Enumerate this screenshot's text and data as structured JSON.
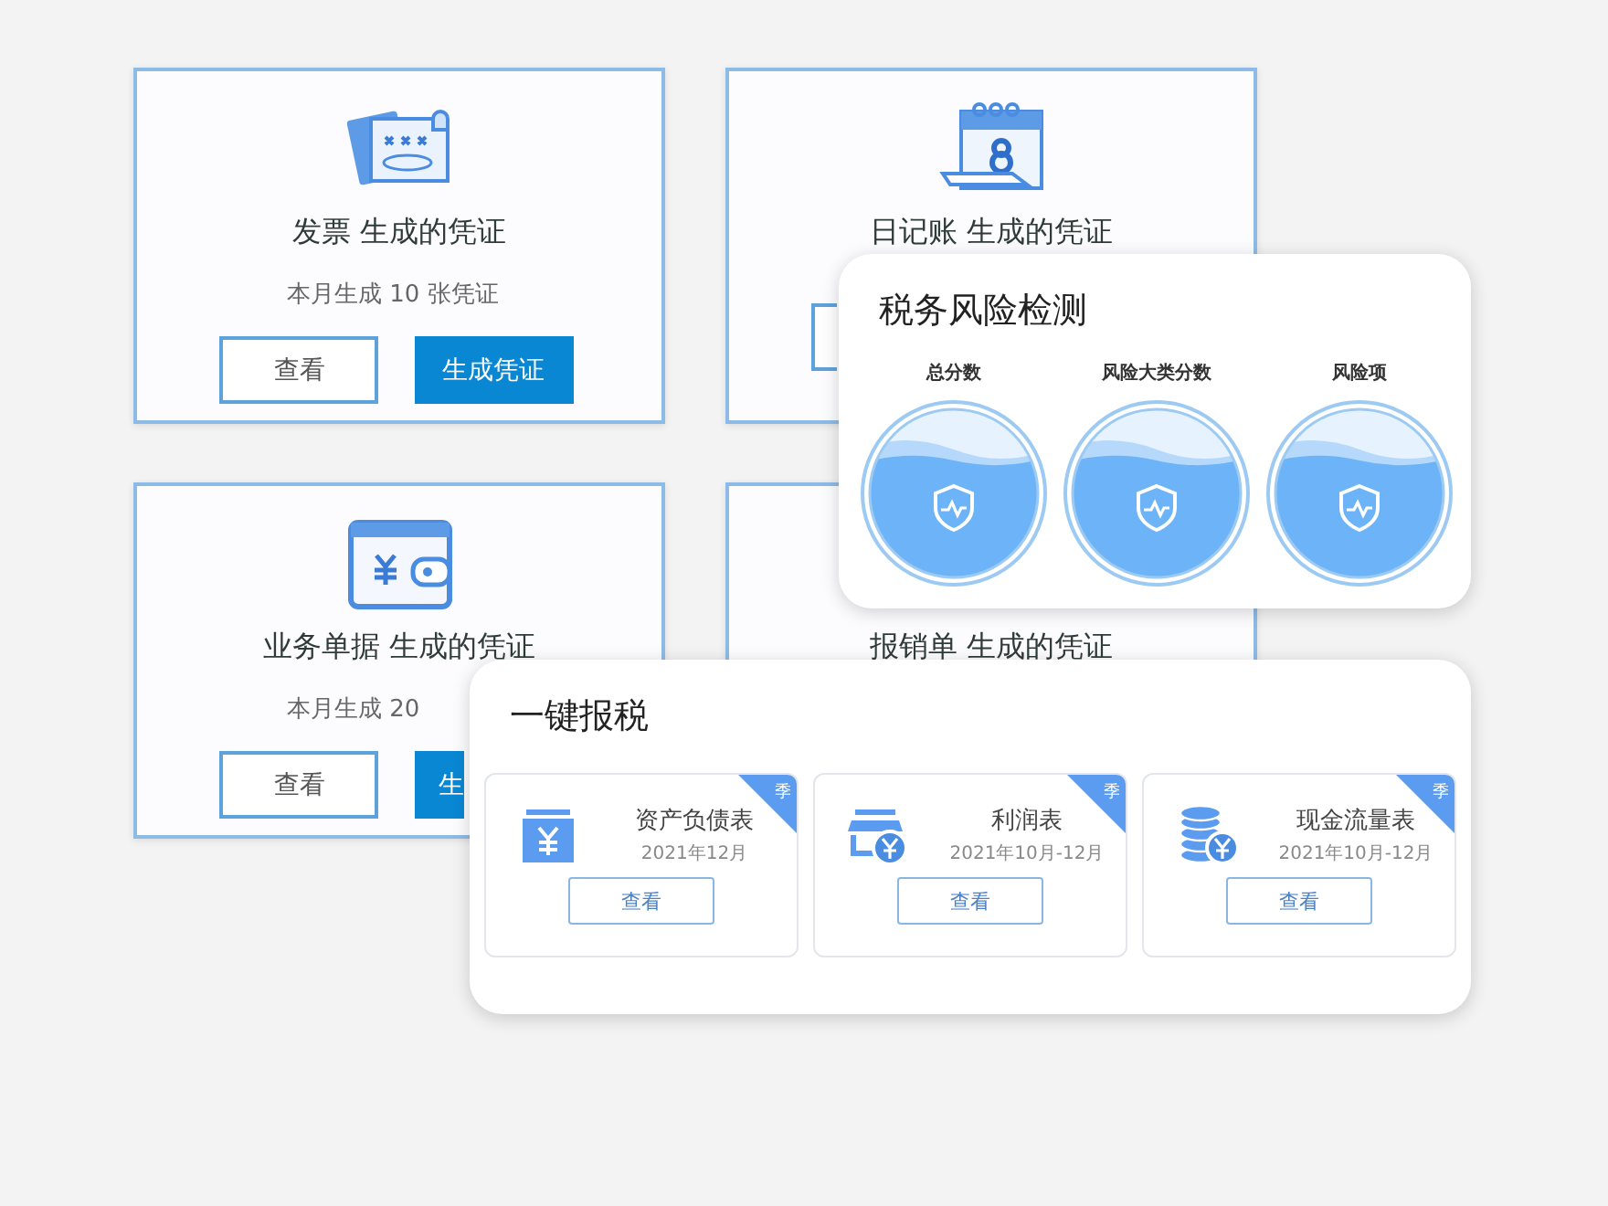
{
  "vouchers": [
    {
      "title": "发票 生成的凭证",
      "subtitle": "本月生成 10 张凭证",
      "buttons": [
        {
          "kind": "outline",
          "label": "查看"
        },
        {
          "kind": "primary",
          "label": "生成凭证"
        }
      ]
    },
    {
      "title": "日记账 生成的凭证",
      "buttons": [
        {
          "kind": "outline"
        }
      ]
    },
    {
      "title": "业务单据 生成的凭证",
      "subtitle": "本月生成 20",
      "buttons": [
        {
          "kind": "outline",
          "label": "查看"
        },
        {
          "kind": "primary",
          "label": "生"
        }
      ]
    },
    {
      "title": "报销单 生成的凭证"
    }
  ],
  "risk_panel": {
    "title": "税务风险检测",
    "gauges": [
      {
        "label": "总分数"
      },
      {
        "label": "风险大类分数"
      },
      {
        "label": "风险项"
      }
    ]
  },
  "tax_panel": {
    "title": "一键报税",
    "reports": [
      {
        "badge": "季",
        "title": "资产负债表",
        "period": "2021年12月",
        "button": "查看"
      },
      {
        "badge": "季",
        "title": "利润表",
        "period": "2021年10月-12月",
        "button": "查看"
      },
      {
        "badge": "季",
        "title": "现金流量表",
        "period": "2021年10月-12月",
        "button": "查看"
      }
    ]
  }
}
